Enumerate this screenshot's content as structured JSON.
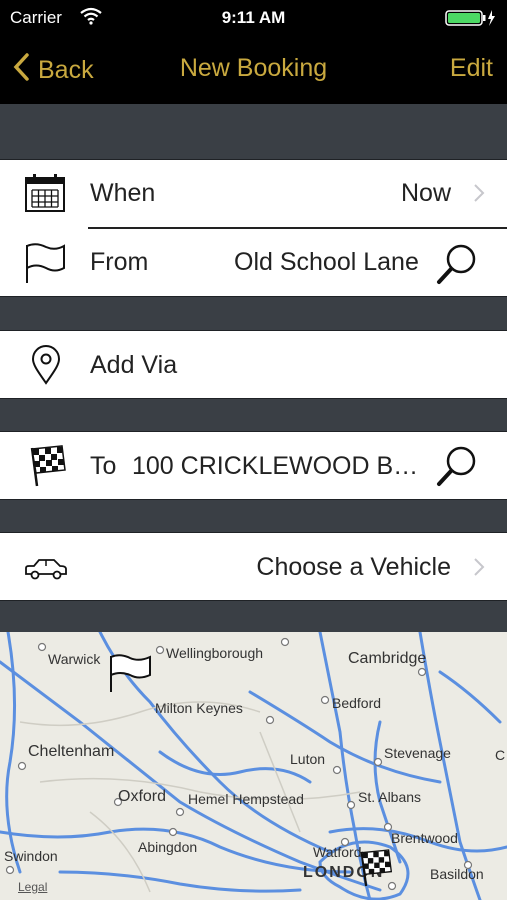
{
  "status": {
    "carrier": "Carrier",
    "time": "9:11 AM"
  },
  "nav": {
    "back_label": "Back",
    "title": "New Booking",
    "edit_label": "Edit"
  },
  "when": {
    "label": "When",
    "value": "Now",
    "icon": "calendar-icon"
  },
  "from": {
    "label": "From",
    "value": "Old School Lane",
    "icon": "flag-icon"
  },
  "via": {
    "label": "Add Via",
    "icon": "location-pin-icon"
  },
  "to": {
    "prefix": "To",
    "value": "100 CRICKLEWOOD B…",
    "icon": "checkered-flag-icon"
  },
  "vehicle": {
    "label": "Choose a Vehicle",
    "icon": "car-icon"
  },
  "map": {
    "legal": "Legal",
    "places": [
      "Warwick",
      "Wellingborough",
      "Cambridge",
      "Milton Keynes",
      "Bedford",
      "Cheltenham",
      "Luton",
      "Stevenage",
      "C",
      "Oxford",
      "Hemel Hempstead",
      "St. Albans",
      "Brentwood",
      "Abingdon",
      "Watford",
      "Swindon",
      "LONDON",
      "Basildon"
    ]
  },
  "colors": {
    "accent": "#c9a93f",
    "road": "#5b8fe0"
  }
}
